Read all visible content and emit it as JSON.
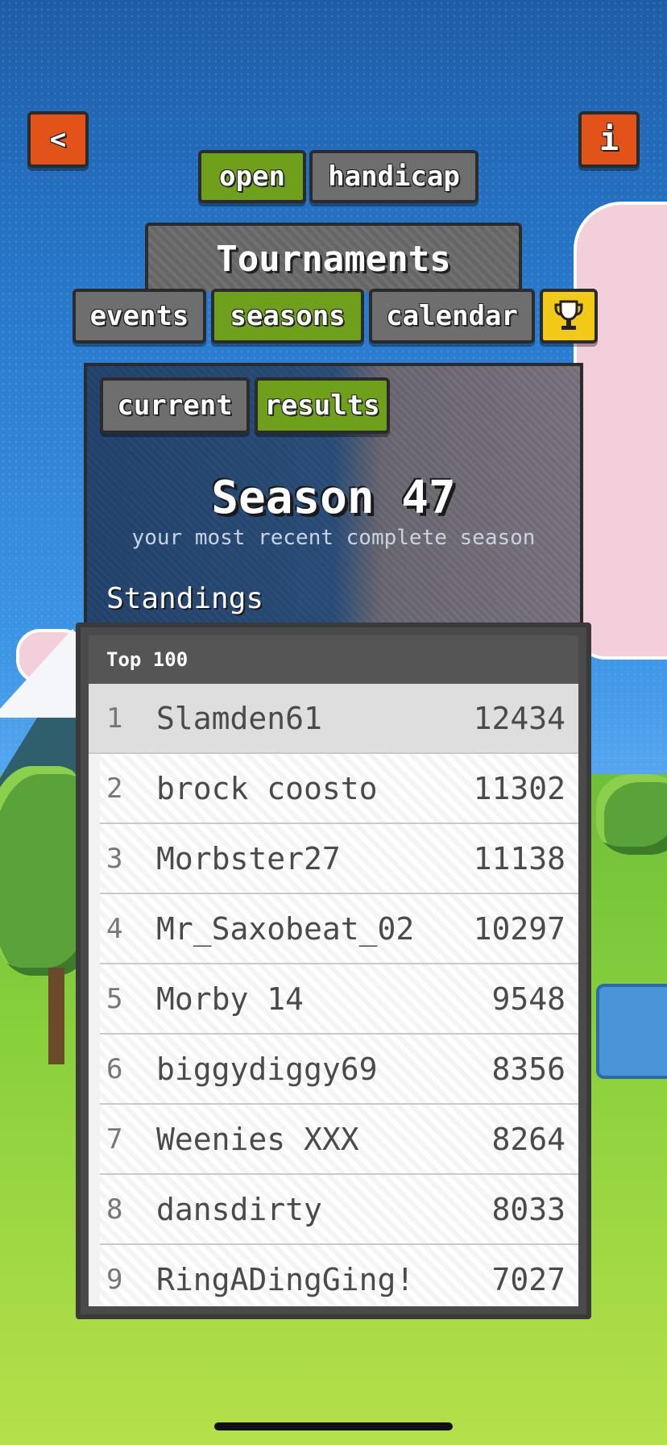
{
  "nav": {
    "back_icon_label": "<",
    "info_icon_label": "i"
  },
  "mode_tabs": [
    {
      "label": "open",
      "active": true
    },
    {
      "label": "handicap",
      "active": false
    }
  ],
  "page_title": "Tournaments",
  "section_tabs": [
    {
      "label": "events",
      "active": false
    },
    {
      "label": "seasons",
      "active": true
    },
    {
      "label": "calendar",
      "active": false
    }
  ],
  "trophy_icon": "trophy-icon",
  "sub_tabs": [
    {
      "label": "current",
      "active": false
    },
    {
      "label": "results",
      "active": true
    }
  ],
  "season": {
    "title": "Season 47",
    "subtitle": "your most recent complete season"
  },
  "standings_label": "Standings",
  "leaderboard": {
    "header": "Top 100",
    "rows": [
      {
        "rank": "1",
        "name": "Slamden61",
        "score": "12434"
      },
      {
        "rank": "2",
        "name": "brock coosto",
        "score": "11302"
      },
      {
        "rank": "3",
        "name": "Morbster27",
        "score": "11138"
      },
      {
        "rank": "4",
        "name": "Mr_Saxobeat_02",
        "score": "10297"
      },
      {
        "rank": "5",
        "name": "Morby 14",
        "score": "9548"
      },
      {
        "rank": "6",
        "name": "biggydiggy69",
        "score": "8356"
      },
      {
        "rank": "7",
        "name": "Weenies XXX",
        "score": "8264"
      },
      {
        "rank": "8",
        "name": "dansdirty",
        "score": "8033"
      },
      {
        "rank": "9",
        "name": "RingADingGing!",
        "score": "7027"
      }
    ]
  },
  "colors": {
    "active_tab": "#6fa01c",
    "inactive_tab": "#6e6e6e",
    "nav_button": "#e2531a",
    "trophy_button": "#f2c916"
  }
}
